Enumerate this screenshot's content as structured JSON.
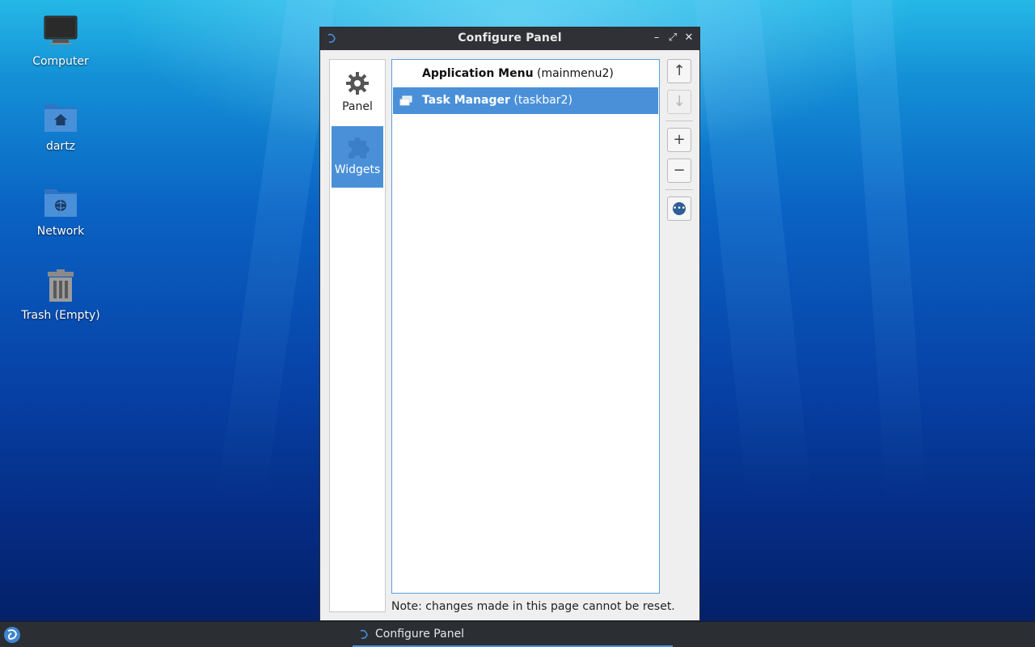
{
  "desktop": {
    "icons": [
      {
        "label": "Computer",
        "icon": "computer-icon"
      },
      {
        "label": "dartz",
        "icon": "home-folder-icon"
      },
      {
        "label": "Network",
        "icon": "network-folder-icon"
      },
      {
        "label": "Trash (Empty)",
        "icon": "trash-icon"
      }
    ]
  },
  "window": {
    "title": "Configure Panel",
    "controls": {
      "minimize": "–",
      "maximize": "⤢",
      "close": "✕"
    },
    "sidebar": {
      "items": [
        {
          "label": "Panel",
          "icon": "gear-icon",
          "active": false
        },
        {
          "label": "Widgets",
          "icon": "puzzle-icon",
          "active": true
        }
      ]
    },
    "widgets": [
      {
        "name": "Application Menu",
        "id": "(mainmenu2)",
        "selected": false
      },
      {
        "name": "Task Manager",
        "id": "(taskbar2)",
        "selected": true
      }
    ],
    "buttons": {
      "up": "↑",
      "down": "↓",
      "add": "+",
      "remove": "−",
      "settings": "•••"
    },
    "note": "Note: changes made in this page cannot be reset."
  },
  "taskbar": {
    "task_label": "Configure Panel"
  },
  "colors": {
    "accent": "#4a90d9",
    "titlebar": "#2f3136",
    "taskbar": "#2b2e33"
  }
}
